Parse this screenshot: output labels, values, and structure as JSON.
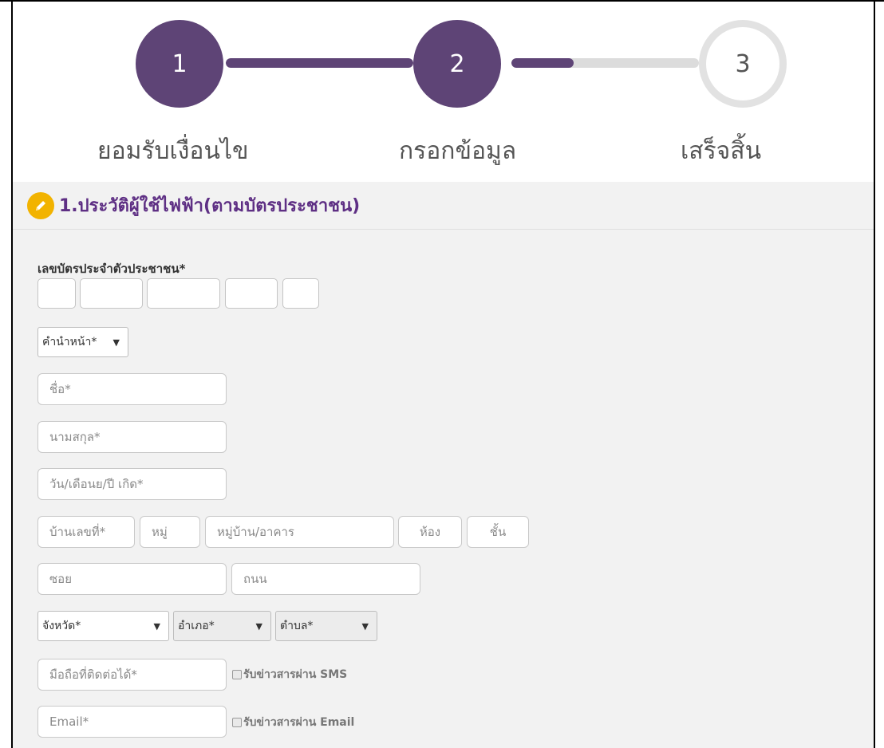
{
  "stepper": {
    "steps": [
      {
        "number": "1",
        "label": "ยอมรับเงื่อนไข",
        "state": "done"
      },
      {
        "number": "2",
        "label": "กรอกข้อมูล",
        "state": "current"
      },
      {
        "number": "3",
        "label": "เสร็จสิ้น",
        "state": "todo"
      }
    ],
    "connector_progress": [
      1.0,
      0.33
    ]
  },
  "section": {
    "title": "1.ประวัติผู้ใช้ไฟฟ้า(ตามบัตรประชาชน)",
    "icon": "pencil-icon"
  },
  "form": {
    "id_card_label": "เลขบัตรประจำตัวประชาชน*",
    "title_select": "คำนำหน้า*",
    "first_name_placeholder": "ชื่อ*",
    "last_name_placeholder": "นามสกุล*",
    "birthdate_placeholder": "วัน/เดือนย/ปี เกิด*",
    "house_no_placeholder": "บ้านเลขที่*",
    "moo_placeholder": "หมู่",
    "village_placeholder": "หมู่บ้าน/อาคาร",
    "room_placeholder": "ห้อง",
    "floor_placeholder": "ชั้น",
    "soi_placeholder": "ซอย",
    "road_placeholder": "ถนน",
    "province_select": "จังหวัด*",
    "district_select": "อำเภอ*",
    "subdistrict_select": "ตำบล*",
    "mobile_placeholder": "มือถือที่ติดต่อได้*",
    "sms_checkbox_label": "รับข่าวสารผ่าน SMS",
    "email_placeholder": "Email*",
    "email_checkbox_label": "รับข่าวสารผ่าน Email"
  },
  "colors": {
    "primary_purple": "#5e4476",
    "title_purple": "#5e2f84",
    "badge_yellow": "#f2b300",
    "section_bg": "#f2f2f2"
  }
}
